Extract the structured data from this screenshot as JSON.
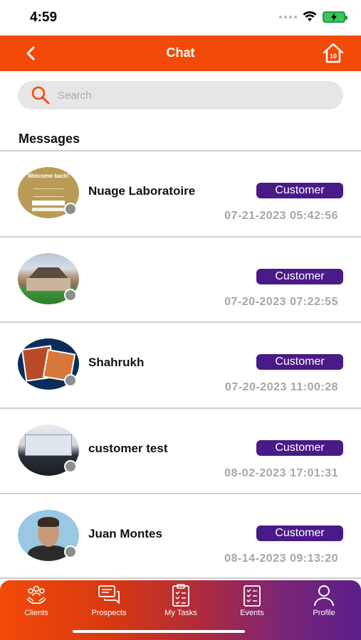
{
  "status_bar": {
    "time": "4:59"
  },
  "header": {
    "title": "Chat",
    "home_badge": "10"
  },
  "search": {
    "placeholder": "Search"
  },
  "section_title": "Messages",
  "chats": [
    {
      "name": "Nuage Laboratoire",
      "badge": "Customer",
      "time": "07-21-2023 05:42:56",
      "avatar_caption": "Welcome back!"
    },
    {
      "name": "",
      "badge": "Customer",
      "time": "07-20-2023 07:22:55"
    },
    {
      "name": "Shahrukh",
      "badge": "Customer",
      "time": "07-20-2023 11:00:28"
    },
    {
      "name": "customer test",
      "badge": "Customer",
      "time": "08-02-2023 17:01:31"
    },
    {
      "name": "Juan Montes",
      "badge": "Customer",
      "time": "08-14-2023 09:13:20"
    }
  ],
  "bottom_nav": [
    {
      "label": "Clients",
      "icon": "clients-icon"
    },
    {
      "label": "Prospects",
      "icon": "prospects-icon"
    },
    {
      "label": "My Tasks",
      "icon": "tasks-icon"
    },
    {
      "label": "Events",
      "icon": "events-icon"
    },
    {
      "label": "Profile",
      "icon": "profile-icon"
    }
  ],
  "colors": {
    "header": "#f24a08",
    "badge": "#4a1a88",
    "time": "#a6a6a6",
    "presence": "#8e8e8e"
  }
}
